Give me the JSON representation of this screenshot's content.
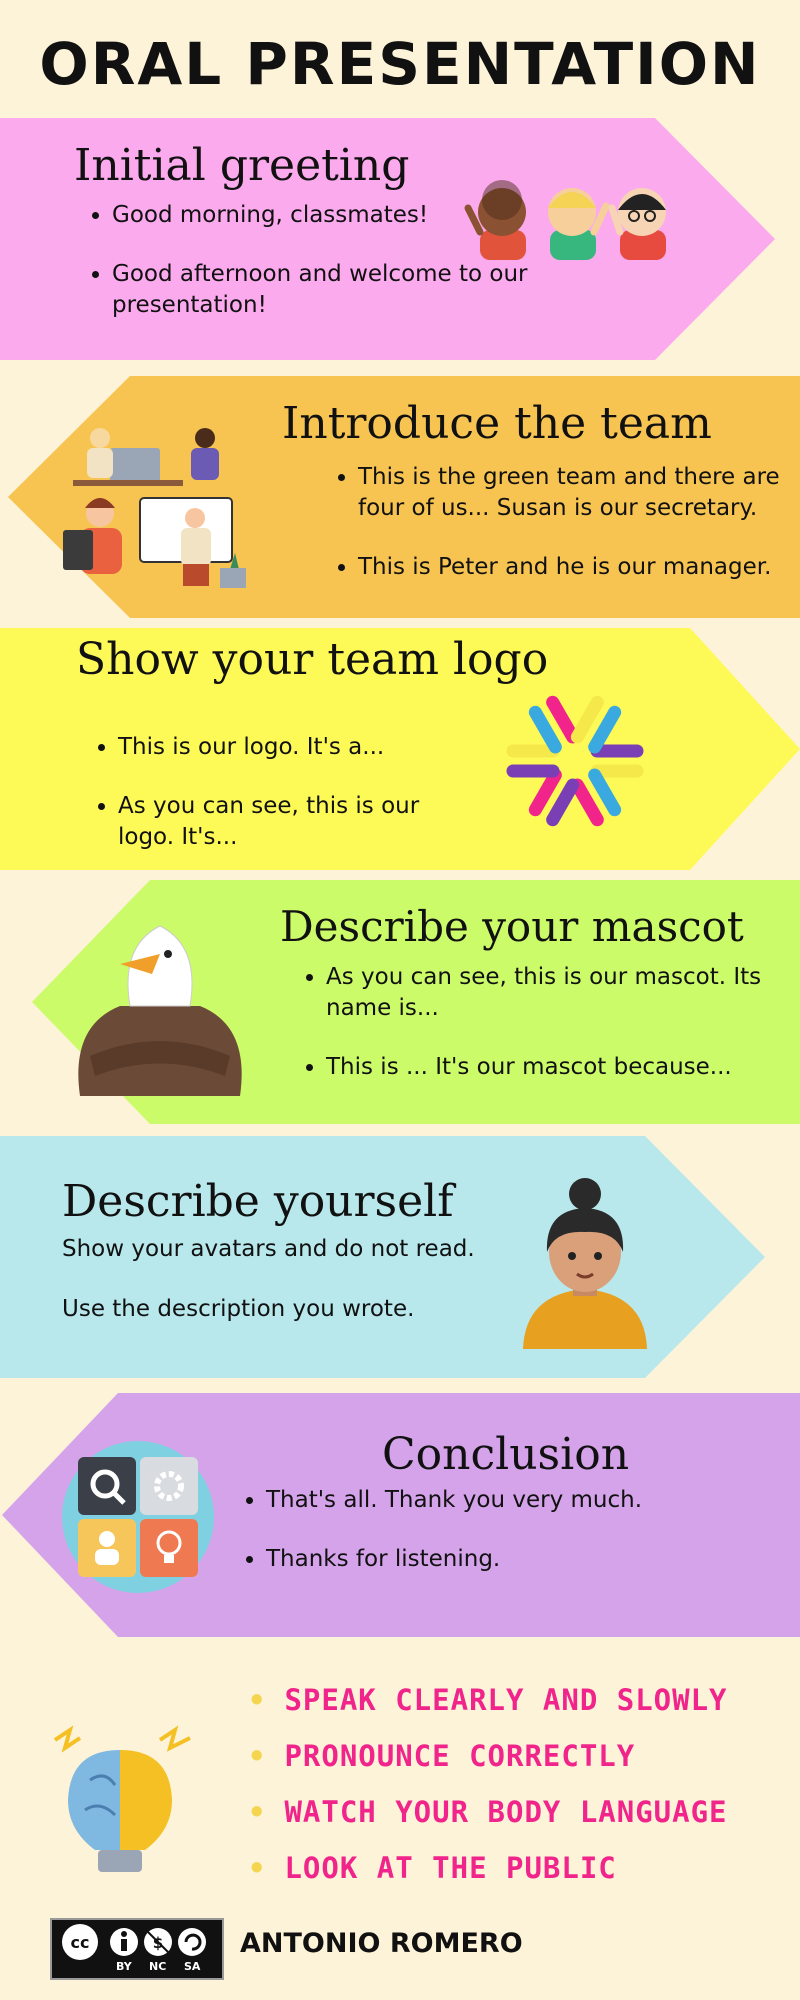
{
  "title": "ORAL PRESENTATION",
  "sections": [
    {
      "heading": "Initial greeting",
      "bullets": [
        "Good morning, classmates!",
        "Good afternoon and welcome to our presentation!"
      ],
      "color": "#fcaaee"
    },
    {
      "heading": "Introduce the team",
      "bullets": [
        "This is the green team and there are four of us... Susan is our secretary.",
        "This is Peter and he is our manager."
      ],
      "color": "#f7c452"
    },
    {
      "heading": "Show your team logo",
      "bullets": [
        "This is our logo. It's a...",
        "As you can see, this is our logo. It's..."
      ],
      "color": "#fdfa58"
    },
    {
      "heading": "Describe your mascot",
      "bullets": [
        "As you can see, this is our mascot. Its name is...",
        "This is ... It's our mascot because..."
      ],
      "color": "#ccfb6a"
    },
    {
      "heading": "Describe yourself",
      "lines": [
        "Show your avatars and do not read.",
        "Use the description you wrote."
      ],
      "color": "#b8e8ec"
    },
    {
      "heading": "Conclusion",
      "bullets": [
        "That's all. Thank you very much.",
        "Thanks for listening."
      ],
      "color": "#d5a3ea"
    }
  ],
  "tips": [
    "SPEAK CLEARLY AND SLOWLY",
    "PRONOUNCE CORRECTLY",
    "WATCH YOUR BODY LANGUAGE",
    "LOOK AT THE PUBLIC"
  ],
  "license": {
    "labels": [
      "BY",
      "NC",
      "SA"
    ]
  },
  "author": "ANTONIO ROMERO",
  "colors": {
    "background": "#fdf3d9",
    "tip_text": "#f0248a",
    "tip_bullet": "#f4d64e"
  }
}
